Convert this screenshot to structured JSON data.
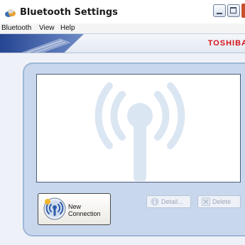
{
  "window": {
    "title": "Bluetooth Settings",
    "icons": {
      "app": "bluetooth-settings-icon",
      "minimize": "minimize-icon",
      "maximize": "maximize-icon"
    }
  },
  "menu": {
    "items": [
      "Bluetooth",
      "View",
      "Help"
    ]
  },
  "banner": {
    "brand": "TOSHIBA"
  },
  "buttons": {
    "new_connection": {
      "line1": "New",
      "line2": "Connection",
      "icon": "antenna-signal-icon"
    },
    "detail": {
      "label": "Detail...",
      "icon": "info-icon",
      "enabled": false
    },
    "delete": {
      "label": "Delete",
      "icon": "delete-icon",
      "enabled": false
    }
  },
  "colors": {
    "panel": "#c8d7ec",
    "watermark": "#dbe6f3",
    "brand": "#d8131b"
  }
}
